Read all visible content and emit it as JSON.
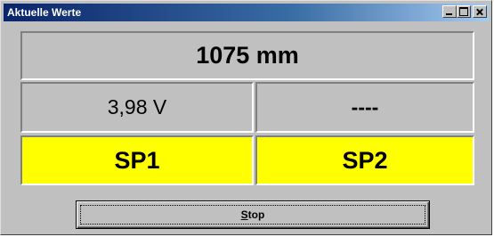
{
  "window": {
    "title": "Aktuelle Werte",
    "buttons": [
      "minimize-icon",
      "maximize-icon",
      "close-icon"
    ]
  },
  "readouts": {
    "distance": "1075 mm",
    "voltage": "3,98 V",
    "secondary": "----"
  },
  "setpoints": {
    "sp1_label": "SP1",
    "sp2_label": "SP2",
    "active_color": "#ffff00"
  },
  "actions": {
    "stop_mnemonic": "S",
    "stop_rest": "top"
  }
}
